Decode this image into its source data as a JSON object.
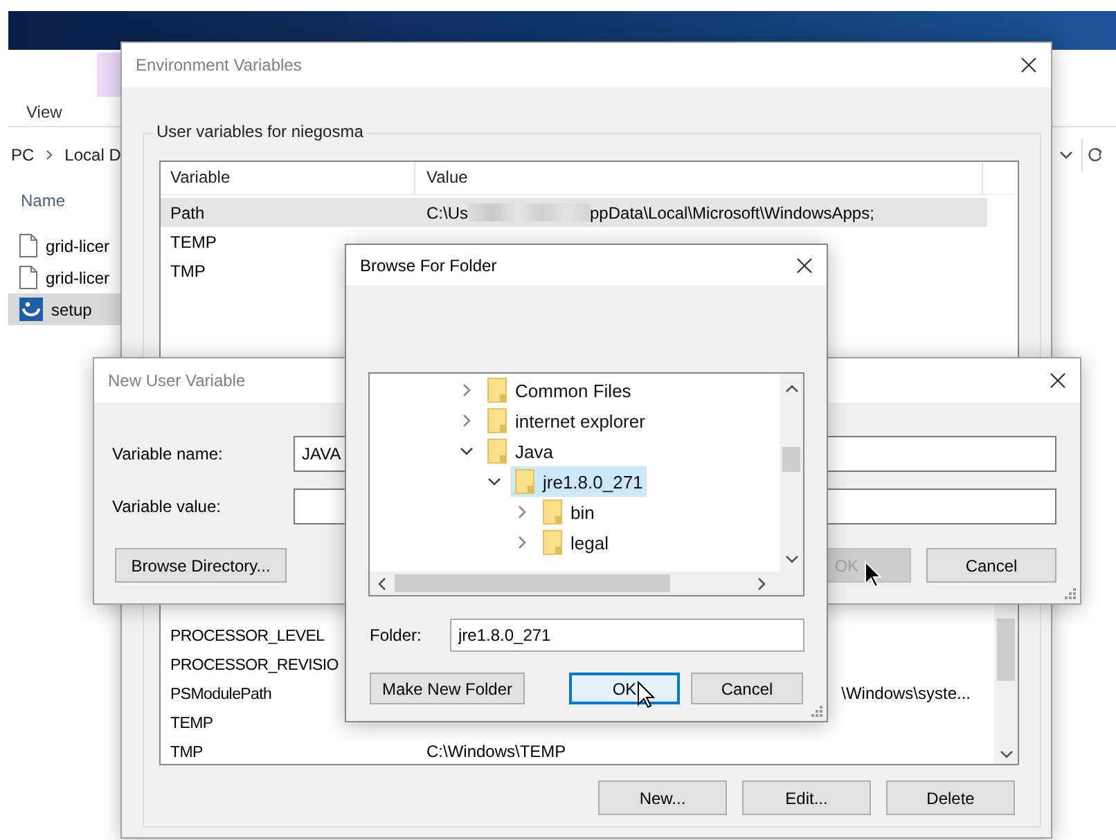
{
  "explorer": {
    "ribbon_tabs": [
      {
        "label": "View"
      }
    ],
    "address": [
      "PC",
      "Local D"
    ],
    "column": "Name",
    "files": [
      {
        "name": "grid-licer",
        "kind": "document",
        "selected": false
      },
      {
        "name": "grid-licer",
        "kind": "document",
        "selected": false
      },
      {
        "name": "setup",
        "kind": "installer",
        "selected": true
      }
    ]
  },
  "environment_variables": {
    "title": "Environment Variables",
    "group": "User variables for niegosma",
    "columns": [
      "Variable",
      "Value"
    ],
    "user_rows": [
      {
        "variable": "Path",
        "value_start": "C:\\Us",
        "value_end": "ppData\\Local\\Microsoft\\WindowsApps;",
        "selected": true
      },
      {
        "variable": "TEMP",
        "selected": false
      },
      {
        "variable": "TMP",
        "selected": false
      }
    ],
    "system_rows": [
      {
        "variable": "PROCESSOR_LEVEL",
        "kind": "plain",
        "selected": false
      },
      {
        "variable": "PROCESSOR_REVISIO",
        "kind": "plain",
        "selected": false
      },
      {
        "variable": "PSModulePath",
        "value": "\\Windows\\syste...",
        "kind": "tail",
        "selected": false
      },
      {
        "variable": "TEMP",
        "kind": "plain",
        "selected": false
      },
      {
        "variable": "TMP",
        "value": "C:\\Windows\\TEMP",
        "kind": "plain",
        "selected": false
      }
    ],
    "buttons": [
      "New...",
      "Edit...",
      "Delete"
    ]
  },
  "new_user_variable": {
    "title": "New User Variable",
    "fields": [
      {
        "label": "Variable name:",
        "value": "JAVA"
      },
      {
        "label": "Variable value:"
      }
    ],
    "buttons": [
      {
        "label": "Browse Directory...",
        "disabled": false
      },
      {
        "label": "OK",
        "disabled": true
      },
      {
        "label": "Cancel",
        "disabled": false
      }
    ]
  },
  "browse_for_folder": {
    "title": "Browse For Folder",
    "tree": [
      {
        "label": "Common Files",
        "expanded": false,
        "selected": false
      },
      {
        "label": "internet explorer",
        "expanded": false,
        "selected": false
      },
      {
        "label": "Java",
        "expanded": true,
        "selected": false,
        "children": [
          {
            "label": "jre1.8.0_271",
            "expanded": true,
            "selected": true,
            "children": [
              {
                "label": "bin",
                "expanded": false,
                "selected": false
              },
              {
                "label": "legal",
                "expanded": false,
                "selected": false
              }
            ]
          }
        ]
      }
    ],
    "folder_label": "Folder:",
    "folder_value": "jre1.8.0_271",
    "buttons": [
      {
        "label": "Make New Folder",
        "focused": false
      },
      {
        "label": "OK",
        "focused": true
      },
      {
        "label": "Cancel",
        "focused": false
      }
    ]
  }
}
